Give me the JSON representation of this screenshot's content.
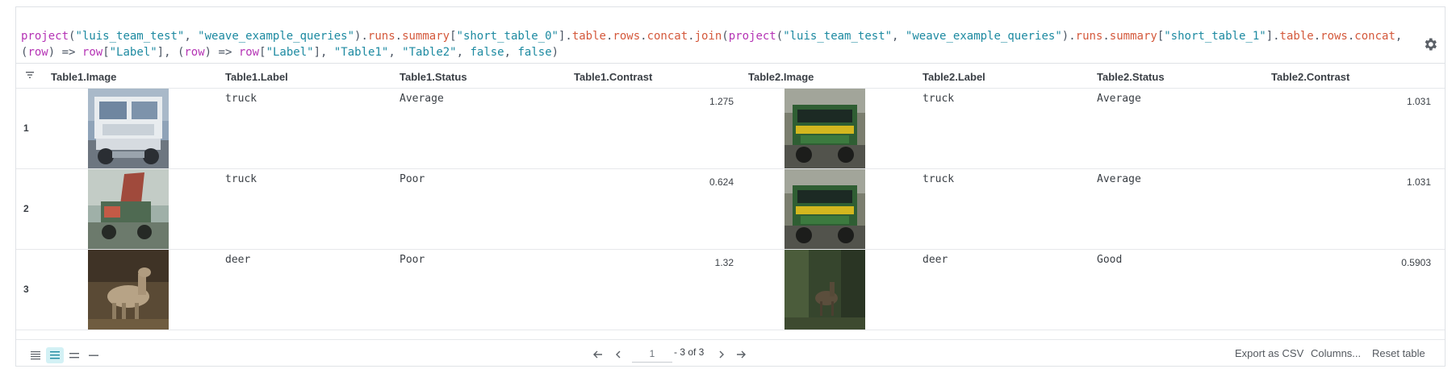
{
  "expression": [
    {
      "t": "project",
      "c": "fn"
    },
    {
      "t": "(",
      "c": "plain"
    },
    {
      "t": "\"luis_team_test\"",
      "c": "str"
    },
    {
      "t": ", ",
      "c": "plain"
    },
    {
      "t": "\"weave_example_queries\"",
      "c": "str"
    },
    {
      "t": ").",
      "c": "plain"
    },
    {
      "t": "runs",
      "c": "op"
    },
    {
      "t": ".",
      "c": "plain"
    },
    {
      "t": "summary",
      "c": "op"
    },
    {
      "t": "[",
      "c": "plain"
    },
    {
      "t": "\"short_table_0\"",
      "c": "str"
    },
    {
      "t": "].",
      "c": "plain"
    },
    {
      "t": "table",
      "c": "op"
    },
    {
      "t": ".",
      "c": "plain"
    },
    {
      "t": "rows",
      "c": "op"
    },
    {
      "t": ".",
      "c": "plain"
    },
    {
      "t": "concat",
      "c": "op"
    },
    {
      "t": ".",
      "c": "plain"
    },
    {
      "t": "join",
      "c": "op"
    },
    {
      "t": "(",
      "c": "plain"
    },
    {
      "t": "project",
      "c": "fn"
    },
    {
      "t": "(",
      "c": "plain"
    },
    {
      "t": "\"luis_team_test\"",
      "c": "str"
    },
    {
      "t": ", ",
      "c": "plain"
    },
    {
      "t": "\"weave_example_queries\"",
      "c": "str"
    },
    {
      "t": ").",
      "c": "plain"
    },
    {
      "t": "runs",
      "c": "op"
    },
    {
      "t": ".",
      "c": "plain"
    },
    {
      "t": "summary",
      "c": "op"
    },
    {
      "t": "[",
      "c": "plain"
    },
    {
      "t": "\"short_table_1\"",
      "c": "str"
    },
    {
      "t": "].",
      "c": "plain"
    },
    {
      "t": "table",
      "c": "op"
    },
    {
      "t": ".",
      "c": "plain"
    },
    {
      "t": "rows",
      "c": "op"
    },
    {
      "t": ".",
      "c": "plain"
    },
    {
      "t": "concat",
      "c": "op"
    },
    {
      "t": ", ",
      "c": "plain"
    },
    {
      "t": "(",
      "c": "plain"
    },
    {
      "t": "row",
      "c": "fn"
    },
    {
      "t": ") => ",
      "c": "plain"
    },
    {
      "t": "row",
      "c": "fn"
    },
    {
      "t": "[",
      "c": "plain"
    },
    {
      "t": "\"Label\"",
      "c": "str"
    },
    {
      "t": "], ",
      "c": "plain"
    },
    {
      "t": "(",
      "c": "plain"
    },
    {
      "t": "row",
      "c": "fn"
    },
    {
      "t": ") => ",
      "c": "plain"
    },
    {
      "t": "row",
      "c": "fn"
    },
    {
      "t": "[",
      "c": "plain"
    },
    {
      "t": "\"Label\"",
      "c": "str"
    },
    {
      "t": "], ",
      "c": "plain"
    },
    {
      "t": "\"Table1\"",
      "c": "str"
    },
    {
      "t": ", ",
      "c": "plain"
    },
    {
      "t": "\"Table2\"",
      "c": "str"
    },
    {
      "t": ", ",
      "c": "plain"
    },
    {
      "t": "false",
      "c": "str"
    },
    {
      "t": ", ",
      "c": "plain"
    },
    {
      "t": "false",
      "c": "str"
    },
    {
      "t": ")",
      "c": "plain"
    }
  ],
  "colors": {
    "fn": "#b534b5",
    "str": "#1d8aa1",
    "op": "#d4593c",
    "plain": "#4b5563"
  },
  "table": {
    "columns": [
      "Table1.Image",
      "Table1.Label",
      "Table1.Status",
      "Table1.Contrast",
      "Table2.Image",
      "Table2.Label",
      "Table2.Status",
      "Table2.Contrast"
    ],
    "rows": [
      {
        "n": "1",
        "t1_image": "truck-white-photo",
        "t1_label": "truck",
        "t1_status": "Average",
        "t1_contrast": "1.275",
        "t2_image": "truck-green-photo",
        "t2_label": "truck",
        "t2_status": "Average",
        "t2_contrast": "1.031"
      },
      {
        "n": "2",
        "t1_image": "dump-truck-photo",
        "t1_label": "truck",
        "t1_status": "Poor",
        "t1_contrast": "0.624",
        "t2_image": "truck-green-photo",
        "t2_label": "truck",
        "t2_status": "Average",
        "t2_contrast": "1.031"
      },
      {
        "n": "3",
        "t1_image": "deer-photo",
        "t1_label": "deer",
        "t1_status": "Poor",
        "t1_contrast": "1.32",
        "t2_image": "deer-forest-photo",
        "t2_label": "deer",
        "t2_status": "Good",
        "t2_contrast": "0.5903"
      }
    ]
  },
  "pagination": {
    "page": "1",
    "of_text": "- 3 of 3"
  },
  "footer": {
    "export": "Export as CSV",
    "columns": "Columns...",
    "reset": "Reset table"
  },
  "icons": [
    "sort-icon",
    "gear-icon",
    "density-compact-icon",
    "density-normal-icon",
    "density-tall-icon",
    "density-collapse-icon",
    "first-page-icon",
    "prev-page-icon",
    "next-page-icon",
    "last-page-icon"
  ]
}
